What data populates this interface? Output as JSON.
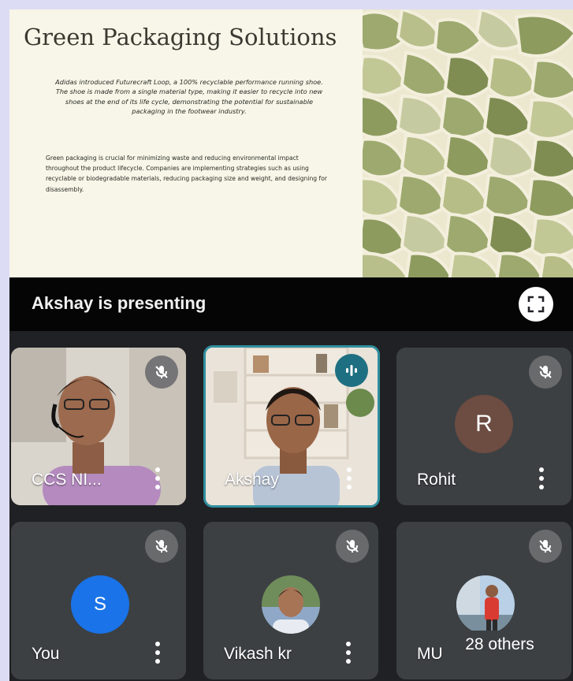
{
  "slide": {
    "title": "Green Packaging Solutions",
    "paragraph1": "Adidas introduced Futurecraft Loop, a 100% recyclable performance running shoe. The shoe is made from a single material type, making it easier to recycle into new shoes at the end of its life cycle, demonstrating the potential for sustainable packaging in the footwear industry.",
    "paragraph2": "Green packaging is crucial for minimizing waste and reducing environmental impact throughout the product lifecycle. Companies are implementing strategies such as using recyclable or biodegradable materials, reducing packaging size and weight, and designing for disassembly."
  },
  "presentation_bar": {
    "label": "Akshay is presenting",
    "fullscreen_icon": "fullscreen-icon"
  },
  "participants": [
    {
      "name": "CCS NI...",
      "mic": "muted",
      "display": "video"
    },
    {
      "name": "Akshay",
      "mic": "speaking",
      "display": "video",
      "active_speaker": true
    },
    {
      "name": "Rohit",
      "mic": "muted",
      "display": "avatar",
      "initial": "R",
      "avatar_color": "#6d4c41"
    },
    {
      "name": "You",
      "mic": "muted",
      "display": "avatar",
      "initial": "S",
      "avatar_color": "#1a73e8"
    },
    {
      "name": "Vikash kr",
      "mic": "muted",
      "display": "photo"
    },
    {
      "name": "MU",
      "mic": "muted",
      "display": "photo"
    }
  ],
  "others_chip": "28 others",
  "colors": {
    "meet_background": "#202124",
    "tile_background": "#3c4043",
    "active_speaker_border": "#2f8f9e",
    "speaking_indicator": "#1f6f82",
    "outer_frame": "#dcdcf5"
  }
}
